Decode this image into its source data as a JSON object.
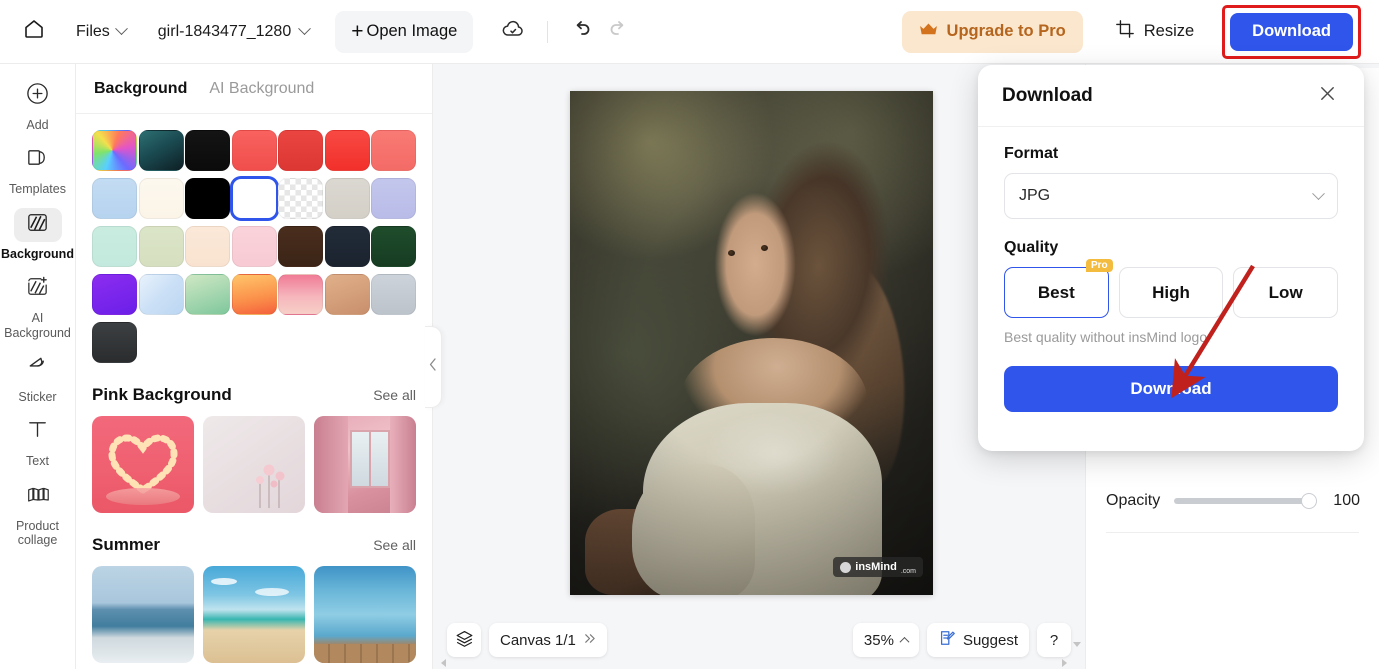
{
  "topbar": {
    "home_icon": "home-icon",
    "files_label": "Files",
    "document_name": "girl-1843477_1280",
    "open_image_label": "Open Image",
    "open_image_plus": "+",
    "cloud_icon": "cloud-saved-icon",
    "undo_icon": "undo-icon",
    "redo_icon": "redo-icon",
    "upgrade_label": "Upgrade to Pro",
    "upgrade_icon": "crown-icon",
    "resize_label": "Resize",
    "resize_icon": "crop-icon",
    "download_label": "Download",
    "accent_blue": "#2f55eb",
    "highlight_red": "#e01b1b",
    "upgrade_bg": "#fbe7ce",
    "upgrade_fg": "#b5651d"
  },
  "rail": {
    "items": [
      {
        "label": "Add",
        "icon": "plus-circle-icon",
        "active": false
      },
      {
        "label": "Templates",
        "icon": "templates-icon",
        "active": false
      },
      {
        "label": "Background",
        "icon": "background-icon",
        "active": true
      },
      {
        "label": "AI Background",
        "icon": "ai-background-icon",
        "active": false
      },
      {
        "label": "Sticker",
        "icon": "sticker-icon",
        "active": false
      },
      {
        "label": "Text",
        "icon": "text-icon",
        "active": false
      },
      {
        "label": "Product collage",
        "icon": "product-collage-icon",
        "active": false
      }
    ]
  },
  "panel": {
    "tabs": [
      {
        "label": "Background",
        "active": true
      },
      {
        "label": "AI Background",
        "active": false
      }
    ],
    "swatches": [
      {
        "name": "rainbow-gradient",
        "css": "conic-gradient(from 200deg at 45% 50%, #59d0ff, #7fe36b, #f4e04d, #ff7a59, #e254c9, #6b6bff, #59d0ff)",
        "selected": false
      },
      {
        "name": "teal-dark-gradient",
        "css": "linear-gradient(150deg,#2c6f72 0%,#1b4b52 45%,#0d1f24 100%)",
        "selected": false
      },
      {
        "name": "near-black",
        "css": "linear-gradient(180deg,#141414 0%,#0b0b0b 100%)",
        "selected": false
      },
      {
        "name": "coral-red",
        "css": "linear-gradient(180deg,#f8625f 0%,#f04e4c 100%)",
        "selected": false
      },
      {
        "name": "strong-red",
        "css": "linear-gradient(180deg,#ea4540 0%,#dd3733 100%)",
        "selected": false
      },
      {
        "name": "bright-red",
        "css": "linear-gradient(180deg,#f84943 0%,#f2302b 100%)",
        "selected": false
      },
      {
        "name": "salmon-red",
        "css": "linear-gradient(180deg,#f97a74 0%,#f46b66 100%)",
        "selected": false
      },
      {
        "name": "light-blue",
        "css": "linear-gradient(180deg,#c3dcf3 0%,#b6d3ef 100%)",
        "selected": false
      },
      {
        "name": "cream-white",
        "css": "linear-gradient(180deg,#fdf8ef 0%,#fbf4e7 100%)",
        "selected": false
      },
      {
        "name": "black",
        "css": "#000000",
        "selected": false
      },
      {
        "name": "white",
        "css": "#ffffff",
        "selected": true
      },
      {
        "name": "transparent",
        "css": "checker",
        "selected": false
      },
      {
        "name": "warm-gray",
        "css": "linear-gradient(180deg,#dbd8d1 0%,#d4d0c8 100%)",
        "selected": false
      },
      {
        "name": "periwinkle",
        "css": "linear-gradient(180deg,#c3c6ec 0%,#b9bce8 100%)",
        "selected": false
      },
      {
        "name": "mint",
        "css": "linear-gradient(180deg,#c9ecdf 0%,#c3e9de 100%)",
        "selected": false
      },
      {
        "name": "sage",
        "css": "linear-gradient(180deg,#dbe4c7 0%,#d6e0c0 100%)",
        "selected": false
      },
      {
        "name": "peach-cream",
        "css": "linear-gradient(180deg,#fbe8d8 0%,#f9e3d0 100%)",
        "selected": false
      },
      {
        "name": "baby-pink",
        "css": "linear-gradient(180deg,#fad3da 0%,#f8cad3 100%)",
        "selected": false
      },
      {
        "name": "dark-brown",
        "css": "linear-gradient(180deg,#4a2e1e 0%,#3b2416 100%)",
        "selected": false
      },
      {
        "name": "navy-charcoal",
        "css": "linear-gradient(180deg,#222c39 0%,#1a232e 100%)",
        "selected": false
      },
      {
        "name": "forest-green",
        "css": "linear-gradient(180deg,#1f4d2c 0%,#173c22 100%)",
        "selected": false
      },
      {
        "name": "violet-gradient",
        "css": "linear-gradient(160deg,#8c2df0 0%,#6b1fe8 100%)",
        "selected": false
      },
      {
        "name": "ice-blue-gradient",
        "css": "linear-gradient(135deg,#e8f2fc 0%,#cbe0f6 50%,#bcd6f2 100%)",
        "selected": false
      },
      {
        "name": "green-gradient",
        "css": "linear-gradient(160deg,#cfe8c4 0%,#7fc79c 100%)",
        "selected": false
      },
      {
        "name": "orange-gradient",
        "css": "linear-gradient(170deg,#ffc56a 0%,#fb8f4a 60%,#f4603c 100%)",
        "selected": false
      },
      {
        "name": "pink-gradient",
        "css": "linear-gradient(180deg,#f07b96 0%,#f6b6bc 55%,#f7cfc7 100%)",
        "selected": false
      },
      {
        "name": "tan-gradient",
        "css": "linear-gradient(160deg,#e0b08a 0%,#c98f6d 100%)",
        "selected": false
      },
      {
        "name": "silver-gradient",
        "css": "linear-gradient(180deg,#cdd3da 0%,#bcc3cb 100%)",
        "selected": false
      },
      {
        "name": "graphite-gradient",
        "css": "linear-gradient(180deg,#3d4042 0%,#2a2c2e 100%)",
        "selected": false
      }
    ],
    "sections": [
      {
        "title": "Pink Background",
        "see_all": "See all",
        "thumbs": [
          {
            "name": "pink-heart-light-podium",
            "class": "heart-bg"
          },
          {
            "name": "pale-pink-flowers",
            "class": "flower-bg"
          },
          {
            "name": "pink-curtain-window",
            "class": "window-bg"
          }
        ]
      },
      {
        "title": "Summer",
        "see_all": "See all",
        "thumbs": [
          {
            "name": "calm-ocean-horizon",
            "class": "sea1"
          },
          {
            "name": "beach-sand-sky",
            "class": "sea2"
          },
          {
            "name": "pool-water-deck",
            "class": "sea3"
          }
        ]
      }
    ],
    "collapse_icon": "chevron-left-icon"
  },
  "canvas": {
    "artboard_alt": "girl-portrait-photo",
    "watermark_text": "insMind",
    "watermark_tld": ".com",
    "layers_icon": "layers-icon",
    "canvas_label": "Canvas 1/1",
    "canvas_expand_icon": "chevron-double-right-icon",
    "zoom_label": "35%",
    "zoom_chevron_icon": "chevron-up-icon",
    "suggest_label": "Suggest",
    "suggest_icon": "suggest-note-icon",
    "help_label": "?"
  },
  "right_panel": {
    "opacity_label": "Opacity",
    "opacity_value": "100",
    "opacity_percent": 100
  },
  "download_popover": {
    "title": "Download",
    "close_icon": "close-icon",
    "format_label": "Format",
    "format_value": "JPG",
    "format_chevron_icon": "chevron-down-icon",
    "quality_label": "Quality",
    "quality_options": [
      {
        "label": "Best",
        "selected": true,
        "badge": "Pro"
      },
      {
        "label": "High",
        "selected": false,
        "badge": ""
      },
      {
        "label": "Low",
        "selected": false,
        "badge": ""
      }
    ],
    "quality_note": "Best quality without insMind logo",
    "download_button_label": "Download",
    "annotation_arrow_color": "#c0211d"
  }
}
